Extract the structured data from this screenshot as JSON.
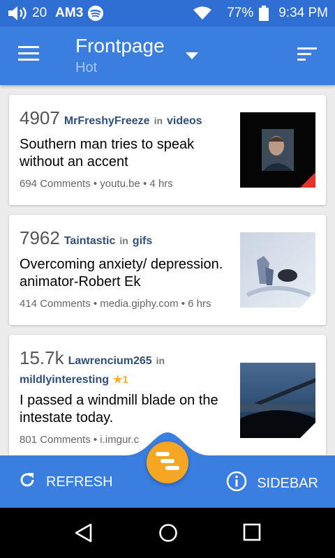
{
  "status": {
    "notif_count": "20",
    "station": "AM3",
    "battery": "77%",
    "time": "9:34 PM"
  },
  "appbar": {
    "title": "Frontpage",
    "subtitle": "Hot"
  },
  "posts": [
    {
      "score": "4907",
      "author": "MrFreshyFreeze",
      "in": "in",
      "subreddit": "videos",
      "title": "Southern man tries to speak without an accent",
      "info": "694 Comments • youtu.be • 4 hrs",
      "corner_color": "#e0342a"
    },
    {
      "score": "7962",
      "author": "Taintastic",
      "in": "in",
      "subreddit": "gifs",
      "title": "Overcoming anxiety/ depression. animator-Robert Ek",
      "info": "414 Comments • media.giphy.com • 6 hrs",
      "corner_color": "#ffffff"
    },
    {
      "score": "15.7k",
      "author": "Lawrencium265",
      "in": "in",
      "subreddit": "mildlyinteresting",
      "gilded": "★1",
      "title": "I passed a windmill blade on the intestate today.",
      "info": "801 Comments • i.imgur.c",
      "corner_color": "#ffffff"
    }
  ],
  "bottombar": {
    "refresh_label": "REFRESH",
    "sidebar_label": "SIDEBAR"
  },
  "colors": {
    "primary": "#3a7ee0",
    "status": "#2f6fd3",
    "fab": "#f6a623",
    "link": "#2f4f7c"
  }
}
